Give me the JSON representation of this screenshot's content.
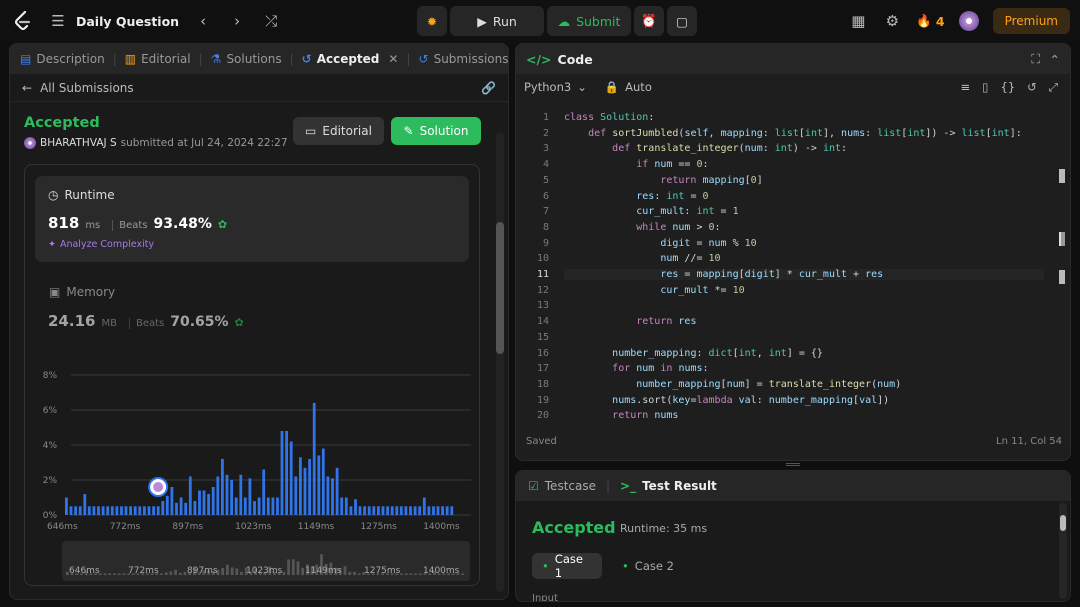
{
  "topbar": {
    "title": "Daily Question",
    "run_label": "Run",
    "submit_label": "Submit",
    "streak": "4",
    "premium_label": "Premium"
  },
  "left": {
    "tabs": [
      {
        "label": "Description"
      },
      {
        "label": "Editorial"
      },
      {
        "label": "Solutions"
      },
      {
        "label": "Accepted"
      },
      {
        "label": "Submissions"
      }
    ],
    "back_label": "All Submissions",
    "status": "Accepted",
    "user": "BHARATHVAJ S",
    "submitted_text": "submitted at Jul 24, 2024 22:27",
    "editorial_btn": "Editorial",
    "solution_btn": "Solution",
    "runtime": {
      "label": "Runtime",
      "value": "818",
      "unit": "ms",
      "beats_label": "Beats",
      "beats": "93.48%",
      "analyze": "Analyze Complexity"
    },
    "memory": {
      "label": "Memory",
      "value": "24.16",
      "unit": "MB",
      "beats_label": "Beats",
      "beats": "70.65%"
    }
  },
  "chart_data": {
    "type": "bar",
    "y_ticks": [
      "8%",
      "6%",
      "4%",
      "2%",
      "0%"
    ],
    "x_ticks": [
      "646ms",
      "772ms",
      "897ms",
      "1023ms",
      "1149ms",
      "1275ms",
      "1400ms"
    ],
    "ylim": [
      0,
      8
    ],
    "values": [
      1.0,
      0.5,
      0.5,
      0.5,
      1.2,
      0.5,
      0.5,
      0.5,
      0.5,
      0.5,
      0.5,
      0.5,
      0.5,
      0.5,
      0.5,
      0.5,
      0.5,
      0.5,
      0.5,
      0.5,
      0.5,
      0.8,
      1.1,
      1.6,
      0.7,
      1.0,
      0.7,
      2.2,
      0.8,
      1.4,
      1.4,
      1.2,
      1.6,
      2.2,
      3.2,
      2.3,
      2.0,
      1.0,
      2.3,
      1.0,
      2.1,
      0.8,
      1.0,
      2.6,
      1.0,
      1.0,
      1.0,
      4.8,
      4.8,
      4.2,
      2.2,
      3.3,
      2.7,
      3.2,
      6.4,
      3.4,
      3.8,
      2.2,
      2.1,
      2.7,
      1.0,
      1.0,
      0.5,
      0.9,
      0.5,
      0.5,
      0.5,
      0.5,
      0.5,
      0.5,
      0.5,
      0.5,
      0.5,
      0.5,
      0.5,
      0.5,
      0.5,
      0.5,
      1.0,
      0.5,
      0.5,
      0.5,
      0.5,
      0.5,
      0.5
    ],
    "highlight_index": 20
  },
  "code": {
    "title": "Code",
    "language": "Python3",
    "mode": "Auto",
    "saved": "Saved",
    "cursor": "Ln 11, Col 54",
    "lines": [
      "class Solution:",
      "    def sortJumbled(self, mapping: list[int], nums: list[int]) -> list[int]:",
      "        def translate_integer(num: int) -> int:",
      "            if num == 0:",
      "                return mapping[0]",
      "            res: int = 0",
      "            cur_mult: int = 1",
      "            while num > 0:",
      "                digit = num % 10",
      "                num //= 10",
      "                res = mapping[digit] * cur_mult + res",
      "                cur_mult *= 10",
      "",
      "            return res",
      "",
      "        number_mapping: dict[int, int] = {}",
      "        for num in nums:",
      "            number_mapping[num] = translate_integer(num)",
      "        nums.sort(key=lambda val: number_mapping[val])",
      "        return nums"
    ]
  },
  "result": {
    "testcase_tab": "Testcase",
    "result_tab": "Test Result",
    "status": "Accepted",
    "runtime": "Runtime: 35 ms",
    "case1": "Case 1",
    "case2": "Case 2",
    "input_label": "Input"
  }
}
